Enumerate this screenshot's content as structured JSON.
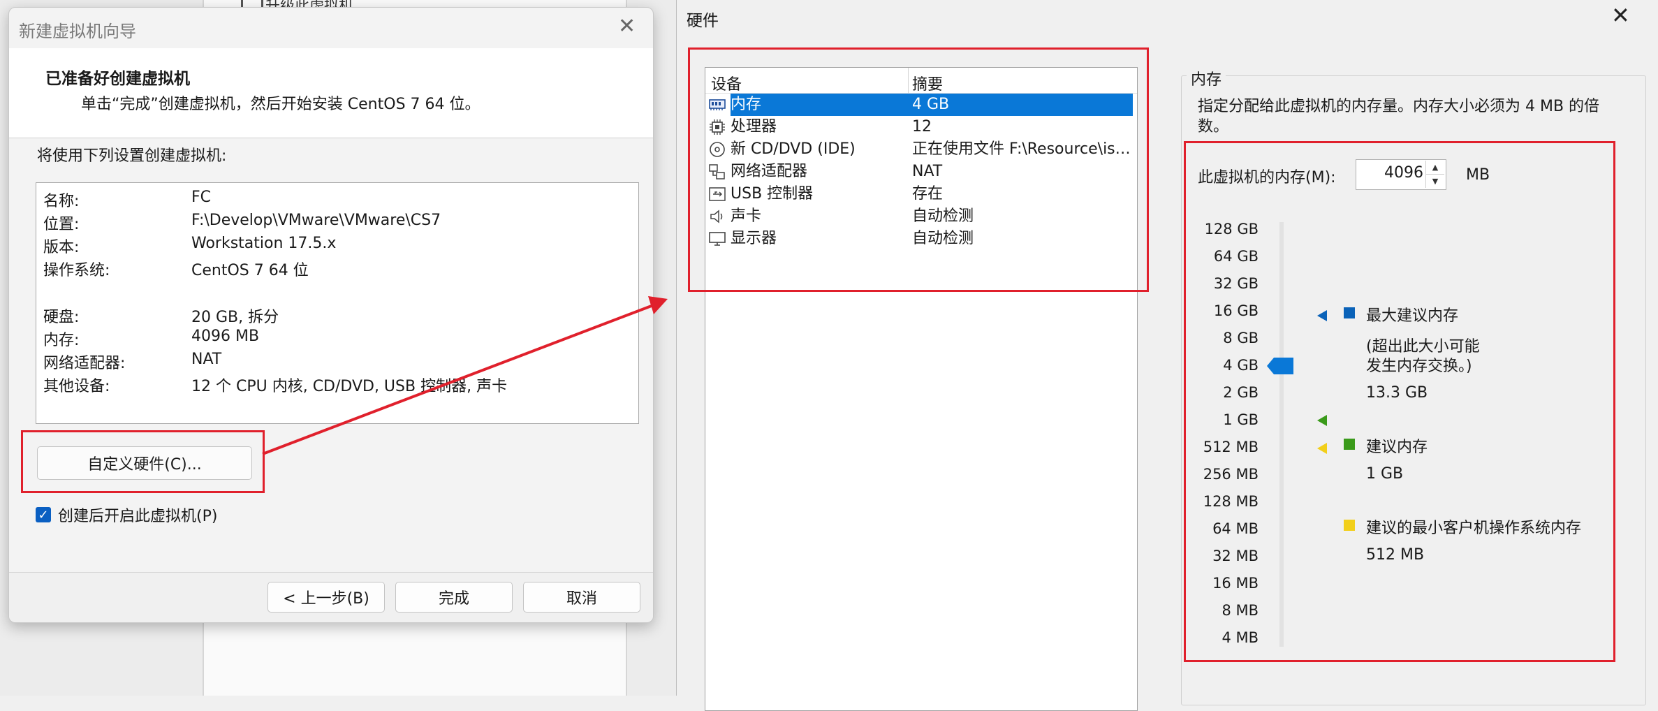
{
  "background": {
    "top_item": "升级此虚拟机"
  },
  "wizard": {
    "title": "新建虚拟机向导",
    "close_glyph": "✕",
    "heading": "已准备好创建虚拟机",
    "subheading": "单击“完成”创建虚拟机，然后开始安装 CentOS 7 64 位。",
    "intro": "将使用下列设置创建虚拟机:",
    "summary": [
      {
        "key": "名称:",
        "value": "FC"
      },
      {
        "key": "位置:",
        "value": "F:\\Develop\\VMware\\VMware\\CS7"
      },
      {
        "key": "版本:",
        "value": "Workstation 17.5.x"
      },
      {
        "key": "操作系统:",
        "value": "CentOS 7 64 位"
      },
      {
        "key": "硬盘:",
        "value": "20 GB, 拆分"
      },
      {
        "key": "内存:",
        "value": "4096 MB"
      },
      {
        "key": "网络适配器:",
        "value": "NAT"
      },
      {
        "key": "其他设备:",
        "value": "12 个 CPU 内核, CD/DVD, USB 控制器, 声卡"
      }
    ],
    "customize_label": "自定义硬件(C)...",
    "autostart_label": "创建后开启此虚拟机(P)",
    "autostart_checked": true,
    "check_glyph": "✓",
    "back_label": "< 上一步(B)",
    "finish_label": "完成",
    "cancel_label": "取消"
  },
  "hardware": {
    "title": "硬件",
    "close_glyph": "✕",
    "columns": {
      "device": "设备",
      "summary": "摘要"
    },
    "devices": [
      {
        "icon": "memory-icon",
        "name": "内存",
        "summary": "4 GB",
        "selected": true
      },
      {
        "icon": "processor-icon",
        "name": "处理器",
        "summary": "12",
        "selected": false
      },
      {
        "icon": "cd-dvd-icon",
        "name": "新 CD/DVD (IDE)",
        "summary": "正在使用文件 F:\\Resource\\iso...",
        "selected": false
      },
      {
        "icon": "network-adapter-icon",
        "name": "网络适配器",
        "summary": "NAT",
        "selected": false
      },
      {
        "icon": "usb-controller-icon",
        "name": "USB 控制器",
        "summary": "存在",
        "selected": false
      },
      {
        "icon": "sound-card-icon",
        "name": "声卡",
        "summary": "自动检测",
        "selected": false
      },
      {
        "icon": "display-icon",
        "name": "显示器",
        "summary": "自动检测",
        "selected": false
      }
    ],
    "memory": {
      "group_title": "内存",
      "description": "指定分配给此虚拟机的内存量。内存大小必须为 4 MB 的倍数。",
      "input_label": "此虚拟机的内存(M):",
      "value": "4096",
      "unit": "MB",
      "spin_up_glyph": "▲",
      "spin_down_glyph": "▼",
      "scale": [
        "128 GB",
        "64 GB",
        "32 GB",
        "16 GB",
        "8 GB",
        "4 GB",
        "2 GB",
        "1 GB",
        "512 MB",
        "256 MB",
        "128 MB",
        "64 MB",
        "32 MB",
        "16 MB",
        "8 MB",
        "4 MB"
      ],
      "current_level": "4 GB",
      "max_recommended_level": "16 GB",
      "recommended_level": "1 GB",
      "min_guest_level": "512 MB",
      "colors": {
        "max": "#0a62b8",
        "recommended": "#3a9a1a",
        "min": "#f2cf1a",
        "highlight": "#e0202c",
        "selection": "#0a78d7"
      },
      "legend": {
        "max_title": "最大建议内存",
        "max_note_1": "(超出此大小可能",
        "max_note_2": "发生内存交换。)",
        "max_value": "13.3 GB",
        "rec_title": "建议内存",
        "rec_value": "1 GB",
        "min_title": "建议的最小客户机操作系统内存",
        "min_value": "512 MB"
      }
    }
  }
}
